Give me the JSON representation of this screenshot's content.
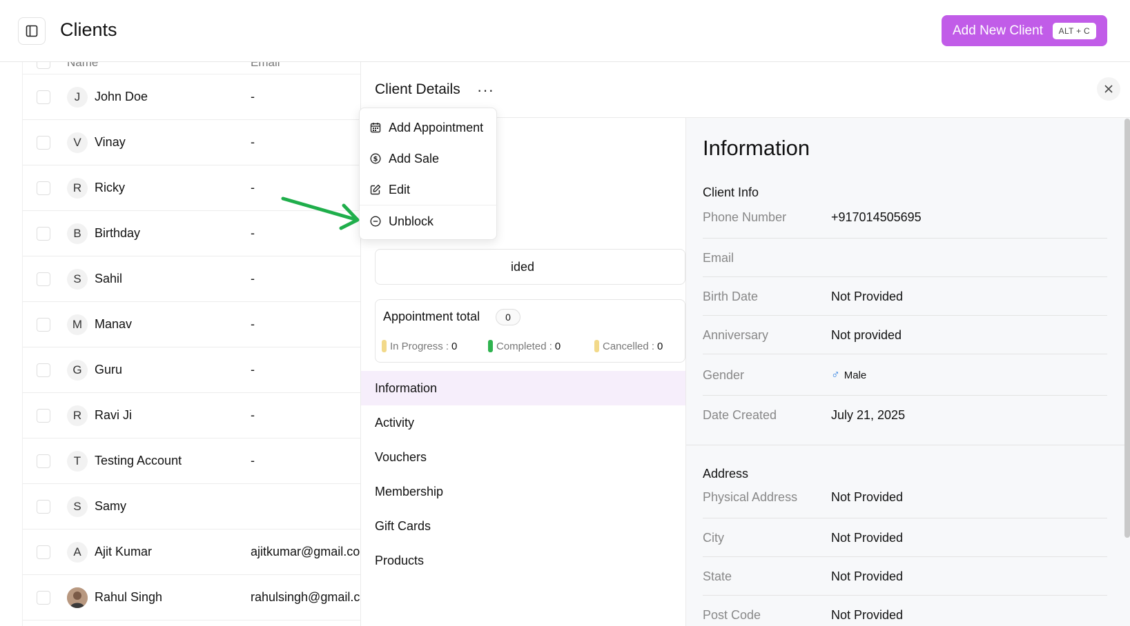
{
  "header": {
    "title": "Clients",
    "add_button_label": "Add New Client",
    "add_button_shortcut": "ALT + C",
    "accent_color": "#c15ce8"
  },
  "list": {
    "columns": [
      "Name",
      "Email"
    ],
    "rows": [
      {
        "initial": "J",
        "name": "John Doe",
        "email": "-"
      },
      {
        "initial": "V",
        "name": "Vinay",
        "email": "-"
      },
      {
        "initial": "R",
        "name": "Ricky",
        "email": "-"
      },
      {
        "initial": "B",
        "name": "Birthday",
        "email": "-"
      },
      {
        "initial": "S",
        "name": "Sahil",
        "email": "-"
      },
      {
        "initial": "M",
        "name": "Manav",
        "email": "-"
      },
      {
        "initial": "G",
        "name": "Guru",
        "email": "-"
      },
      {
        "initial": "R",
        "name": "Ravi Ji",
        "email": "-"
      },
      {
        "initial": "T",
        "name": "Testing Account",
        "email": "-"
      },
      {
        "initial": "S",
        "name": "Samy",
        "email": ""
      },
      {
        "initial": "A",
        "name": "Ajit Kumar",
        "email": "ajitkumar@gmail.co"
      },
      {
        "initial": "",
        "name": "Rahul Singh",
        "email": "rahulsingh@gmail.c"
      }
    ]
  },
  "panel": {
    "title": "Client Details",
    "status_partial": "ided",
    "appointments": {
      "label": "Appointment total",
      "total": "0",
      "in_progress_label": "In Progress :",
      "in_progress": "0",
      "completed_label": "Completed :",
      "completed": "0",
      "cancelled_label": "Cancelled :",
      "cancelled": "0"
    },
    "nav": [
      "Information",
      "Activity",
      "Vouchers",
      "Membership",
      "Gift Cards",
      "Products"
    ]
  },
  "menu": {
    "items": [
      "Add Appointment",
      "Add Sale",
      "Edit",
      "Unblock"
    ]
  },
  "info": {
    "title": "Information",
    "client_info_title": "Client Info",
    "fields": [
      {
        "label": "Phone Number",
        "value": "+917014505695"
      },
      {
        "label": "Email",
        "value": ""
      },
      {
        "label": "Birth Date",
        "value": "Not Provided"
      },
      {
        "label": "Anniversary",
        "value": "Not provided"
      },
      {
        "label": "Gender",
        "value": "Male"
      },
      {
        "label": "Date Created",
        "value": "July 21, 2025"
      }
    ],
    "address_title": "Address",
    "address_fields": [
      {
        "label": "Physical Address",
        "value": "Not Provided"
      },
      {
        "label": "City",
        "value": "Not Provided"
      },
      {
        "label": "State",
        "value": "Not Provided"
      },
      {
        "label": "Post Code",
        "value": "Not Provided"
      }
    ]
  }
}
